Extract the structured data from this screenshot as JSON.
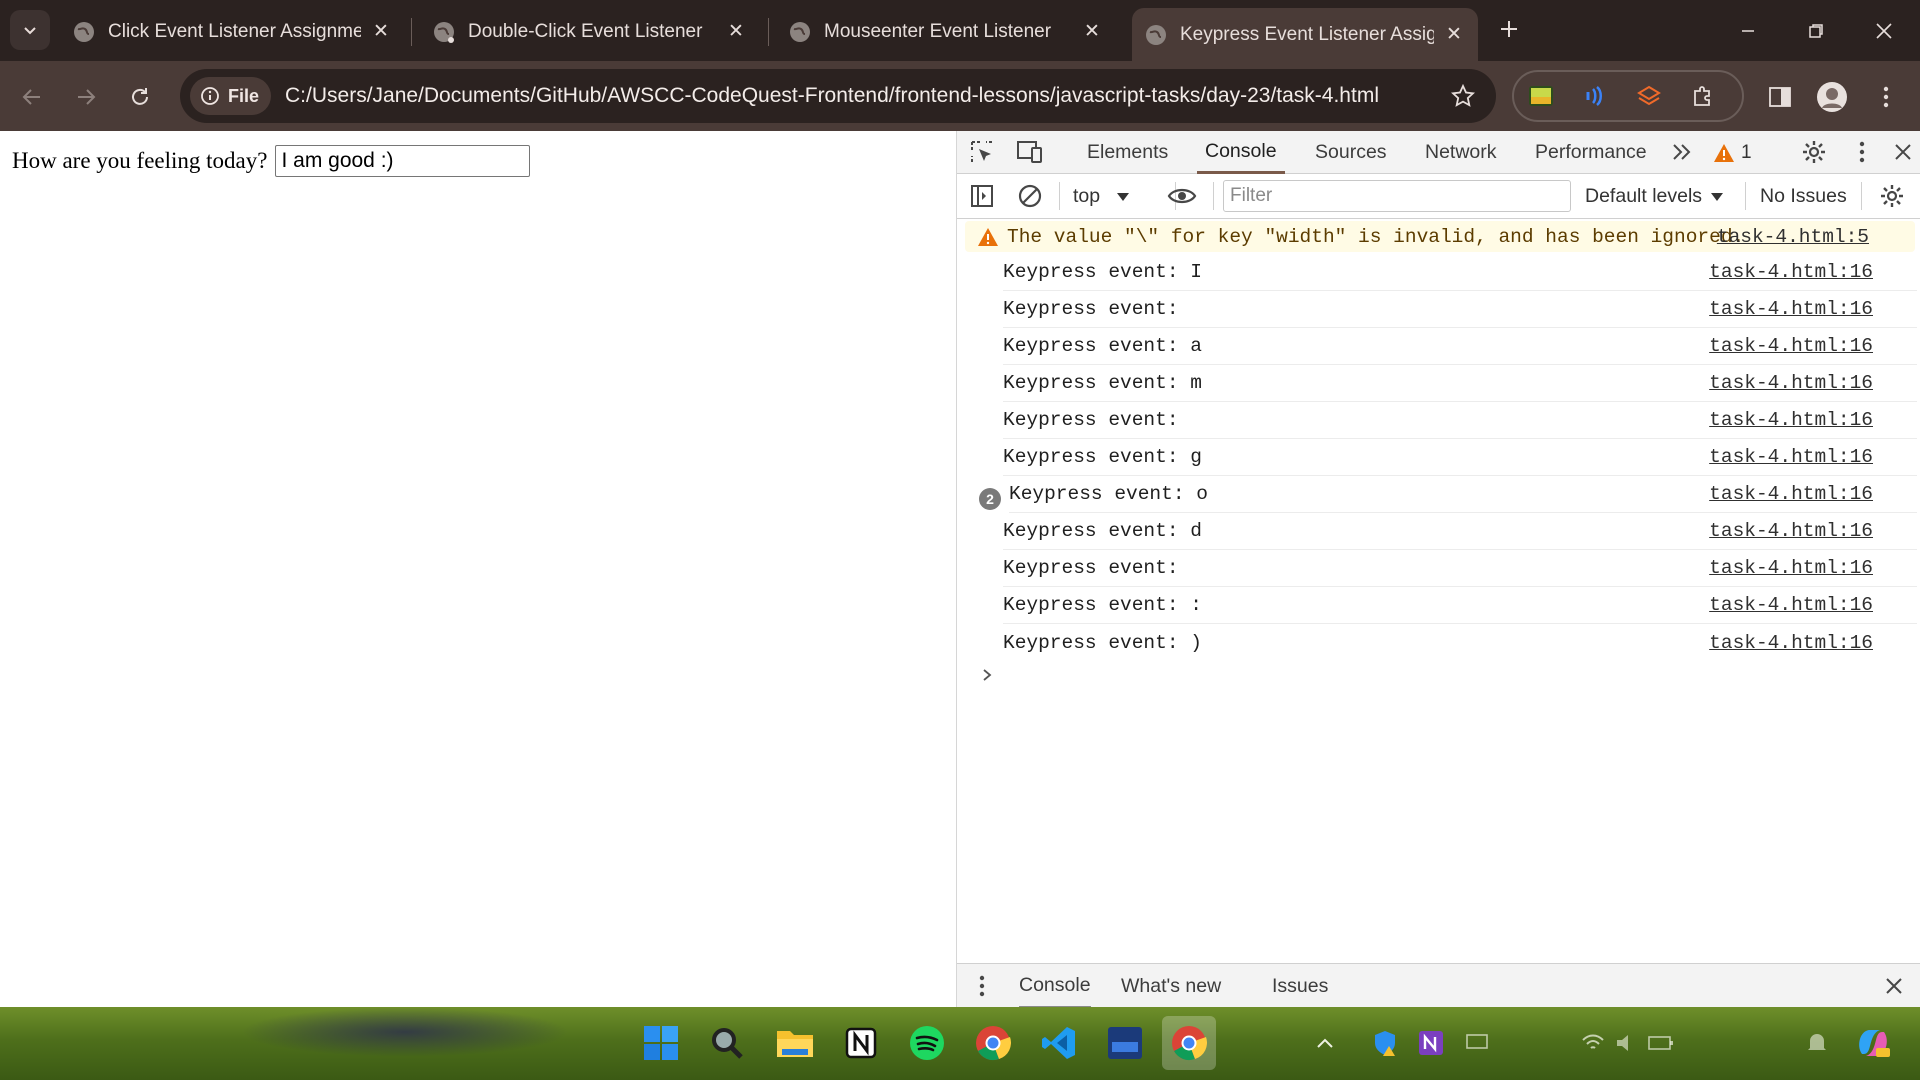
{
  "browser": {
    "tabs": [
      {
        "title": "Click Event Listener Assignment"
      },
      {
        "title": "Double-Click Event Listener"
      },
      {
        "title": "Mouseenter Event Listener"
      },
      {
        "title": "Keypress Event Listener Assignm"
      }
    ],
    "active_tab_index": 3,
    "address": {
      "scheme_chip": "File",
      "url": "C:/Users/Jane/Documents/GitHub/AWSCC-CodeQuest-Frontend/frontend-lessons/javascript-tasks/day-23/task-4.html"
    }
  },
  "page": {
    "question": "How are you feeling today?",
    "input_value": "I am good :)"
  },
  "devtools": {
    "tabs": [
      "Elements",
      "Console",
      "Sources",
      "Network",
      "Performance"
    ],
    "active_tab": "Console",
    "warning_count": "1",
    "console_toolbar": {
      "context": "top",
      "filter_placeholder": "Filter",
      "levels": "Default levels",
      "issues": "No Issues"
    },
    "warning": {
      "text": "The value \"\\\" for key \"width\" is invalid, and has been ignored.",
      "source": "task-4.html:5"
    },
    "logs": [
      {
        "text": "Keypress event: I",
        "source": "task-4.html:16"
      },
      {
        "text": "Keypress event:",
        "source": "task-4.html:16"
      },
      {
        "text": "Keypress event: a",
        "source": "task-4.html:16"
      },
      {
        "text": "Keypress event: m",
        "source": "task-4.html:16"
      },
      {
        "text": "Keypress event:",
        "source": "task-4.html:16"
      },
      {
        "text": "Keypress event: g",
        "source": "task-4.html:16"
      },
      {
        "text": "Keypress event: o",
        "source": "task-4.html:16",
        "repeat": "2"
      },
      {
        "text": "Keypress event: d",
        "source": "task-4.html:16"
      },
      {
        "text": "Keypress event:",
        "source": "task-4.html:16"
      },
      {
        "text": "Keypress event: :",
        "source": "task-4.html:16"
      },
      {
        "text": "Keypress event: )",
        "source": "task-4.html:16"
      }
    ],
    "drawer_tabs": [
      "Console",
      "What's new",
      "Issues"
    ]
  },
  "colors": {
    "tabstrip_bg": "#2b2220",
    "toolbar_bg": "#4a3b37",
    "warning_bg": "#fffbe5",
    "warning_icon": "#e8710a"
  }
}
